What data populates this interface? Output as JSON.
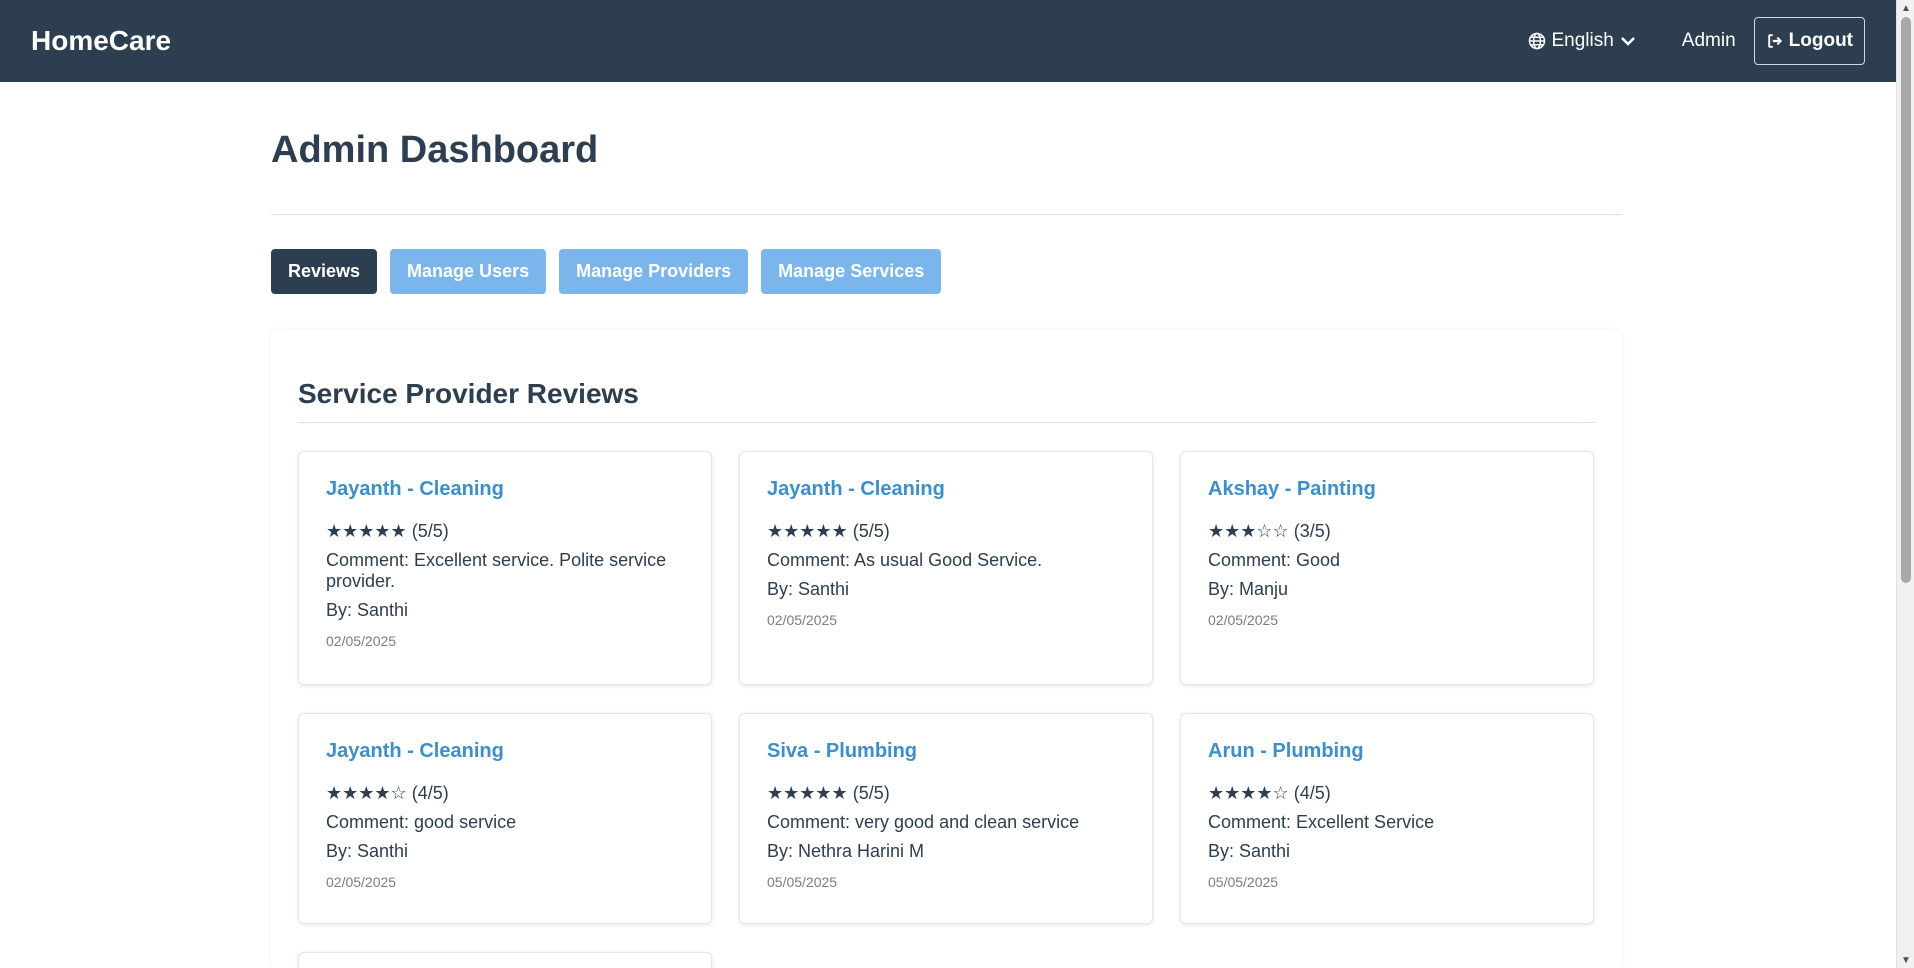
{
  "navbar": {
    "brand": "HomeCare",
    "language": "English",
    "admin": "Admin",
    "logout": "Logout"
  },
  "page": {
    "title": "Admin Dashboard"
  },
  "tabs": [
    {
      "label": "Reviews",
      "active": true
    },
    {
      "label": "Manage Users",
      "active": false
    },
    {
      "label": "Manage Providers",
      "active": false
    },
    {
      "label": "Manage Services",
      "active": false
    }
  ],
  "reviews": {
    "title": "Service Provider Reviews",
    "items": [
      {
        "title": "Jayanth - Cleaning",
        "stars": "★★★★★",
        "score": "(5/5)",
        "comment": "Comment: Excellent service. Polite service provider.",
        "by": "By: Santhi",
        "date": "02/05/2025"
      },
      {
        "title": "Jayanth - Cleaning",
        "stars": "★★★★★",
        "score": "(5/5)",
        "comment": "Comment: As usual Good Service.",
        "by": "By: Santhi",
        "date": "02/05/2025"
      },
      {
        "title": "Akshay - Painting",
        "stars": "★★★☆☆",
        "score": "(3/5)",
        "comment": "Comment: Good",
        "by": "By: Manju",
        "date": "02/05/2025"
      },
      {
        "title": "Jayanth - Cleaning",
        "stars": "★★★★☆",
        "score": "(4/5)",
        "comment": "Comment: good service",
        "by": "By: Santhi",
        "date": "02/05/2025"
      },
      {
        "title": "Siva - Plumbing",
        "stars": "★★★★★",
        "score": "(5/5)",
        "comment": "Comment: very good and clean service",
        "by": "By: Nethra Harini M",
        "date": "05/05/2025"
      },
      {
        "title": "Arun - Plumbing",
        "stars": "★★★★☆",
        "score": "(4/5)",
        "comment": "Comment: Excellent Service",
        "by": "By: Santhi",
        "date": "05/05/2025"
      }
    ]
  },
  "colors": {
    "navbar": "#2c3e50",
    "tab_active": "#2c3e50",
    "tab_inactive": "#7ab6ec",
    "card_title": "#3a8fd0"
  }
}
